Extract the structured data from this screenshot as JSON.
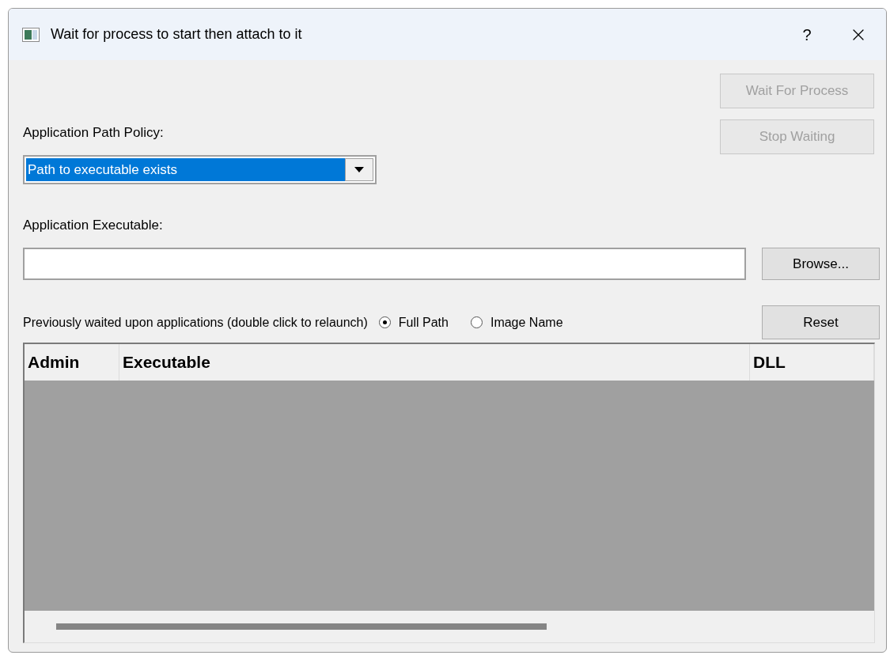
{
  "window": {
    "title": "Wait for process to start then attach to it",
    "help": "?"
  },
  "actions": [
    {
      "label": "Wait For Process",
      "disabled": true
    },
    {
      "label": "Stop Waiting",
      "disabled": true
    }
  ],
  "policy": {
    "label": "Application Path Policy:",
    "value": "Path to executable exists"
  },
  "executable": {
    "label": "Application Executable:",
    "browse": "Browse..."
  },
  "history": {
    "label": "Previously waited upon applications (double click to relaunch)",
    "options": [
      {
        "label": "Full Path",
        "selected": true
      },
      {
        "label": "Image Name",
        "selected": false
      }
    ],
    "reset": "Reset"
  },
  "table": {
    "columns": [
      "Admin",
      "Executable",
      "DLL"
    ]
  }
}
